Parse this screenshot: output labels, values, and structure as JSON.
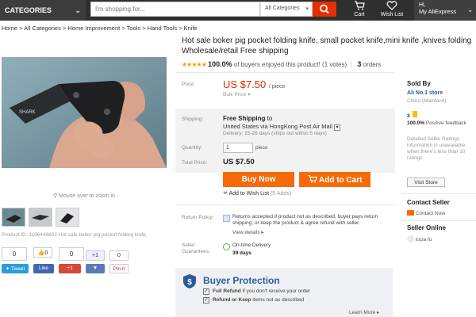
{
  "header": {
    "categories_label": "CATEGORIES",
    "search_placeholder": "I'm shopping for...",
    "search_category": "All Categories",
    "cart_label": "Cart",
    "wishlist_label": "Wish List",
    "greeting": "Hi,",
    "account_label": "My AliExpress"
  },
  "breadcrumb": "Home > All Categories > Home Improvement > Tools > Hand Tools > Knife",
  "gallery": {
    "zoom_hint": "Mouse over to zoom in",
    "product_id": "Product ID: 1196446602 Hot sale boker pig pocket folding knife,"
  },
  "social": {
    "count_a": "0",
    "like_count_1": "0",
    "count_b": "0",
    "plus1": "+1",
    "count_c": "0",
    "tweet": "Tweet",
    "like": "Like",
    "gplus": "+1",
    "share": "▼",
    "pinit": "Pin it"
  },
  "product": {
    "title": "Hot sale boker pig pocket folding knife, small pocket knife,mini knife ,knives folding Wholesale/retail Free shipping",
    "stars": "★★★★★",
    "rating_percent": "100.0%",
    "rating_text": "of buyers enjoyed this product! (1 votes)",
    "orders_count": "3",
    "orders_label": "orders"
  },
  "pricing": {
    "price_label": "Price:",
    "price": "US $7.50",
    "unit": "/ piece",
    "bulk_price": "Bulk Price ▾"
  },
  "shipping": {
    "label": "Shipping:",
    "free": "Free Shipping",
    "to": "to",
    "route": "United States via HongKong Post Air Mail",
    "delivery": "Delivery: 15-26 days (ships out within 5 days)",
    "quantity_label": "Quantity:",
    "quantity_value": "1",
    "quantity_unit": "piece",
    "total_label": "Total Price:",
    "total": "US $7.50"
  },
  "actions": {
    "buy_now": "Buy Now",
    "add_to_cart": "Add to Cart",
    "add_to_wishlist": "Add to Wish List",
    "wishlist_count": "(5 Adds)"
  },
  "policy": {
    "return_label": "Return Policy:",
    "return_text": "Returns accepted if product not as described, buyer pays return shipping; or keep the product & agree refund with seller.",
    "view_details": "View details ▸",
    "guarantee_label": "Seller Guarantees:",
    "ontime": "On-time Delivery",
    "days": "39 days"
  },
  "protection": {
    "title": "Buyer Protection",
    "full_refund_bold": "Full Refund",
    "full_refund_rest": "if you don't receive your order",
    "refund_keep_bold": "Refund or Keep",
    "refund_keep_rest": "items not as described",
    "learn_more": "Learn More ▸"
  },
  "seller": {
    "sold_by_label": "Sold By",
    "store_name": "Ali No.1 store",
    "location": "China (Mainland)",
    "score": "3",
    "feedback_percent": "100.0%",
    "feedback_label": "Positive feedback",
    "ratings_note": "Detailed Seller Ratings information is unavailable when there's less than 10 ratings",
    "visit_store": "Visit Store",
    "contact_heading": "Contact Seller",
    "contact_now": "Contact Now",
    "online_heading": "Seller Online",
    "online_name": "lucia fu"
  },
  "colors": {
    "accent": "#e62e04",
    "button": "#f66a0a",
    "protection_blue": "#2d5a9e",
    "star": "#ff9900"
  }
}
